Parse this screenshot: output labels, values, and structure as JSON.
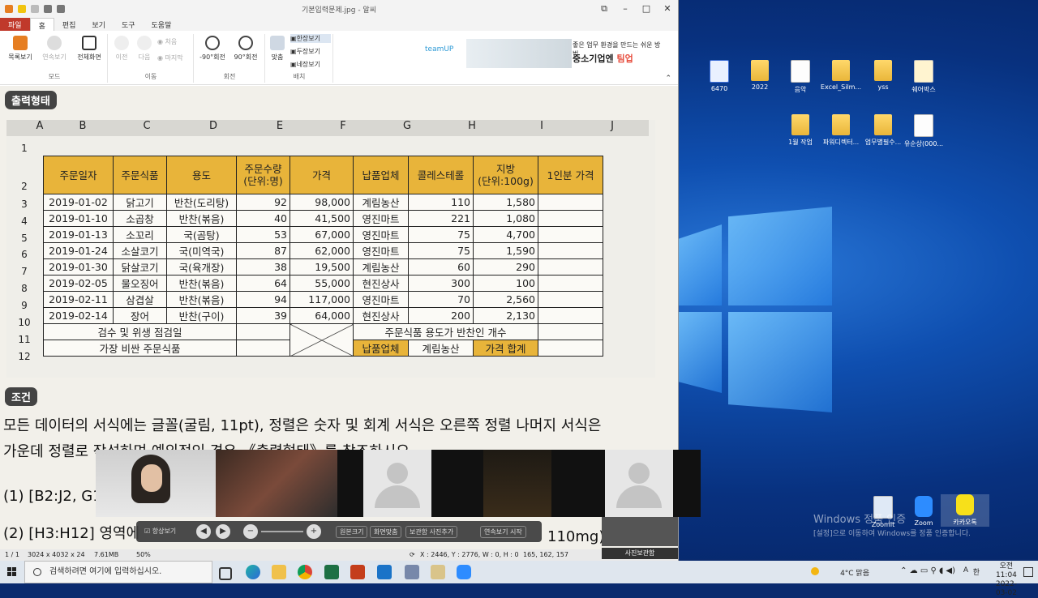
{
  "window": {
    "title": "기본입력문제.jpg - 알씨",
    "buttons": [
      "⧉",
      "–",
      "□",
      "✕"
    ]
  },
  "ribbon": {
    "tabs": [
      "파일",
      "홈",
      "편집",
      "보기",
      "도구",
      "도움말"
    ],
    "buttons": {
      "list_view": "목록보기",
      "slideshow": "연속보기",
      "fullscreen": "전체화면",
      "prev": "이전",
      "next": "다음",
      "first": "처음",
      "last": "마지막",
      "rot_ccw": "-90°회전",
      "rot_cw": "90°회전",
      "fit": "맞춤",
      "one_page": "한장보기",
      "two_page": "두장보기",
      "four_page": "네장보기"
    },
    "groups": {
      "mode": "모드",
      "move": "이동",
      "rotate": "회전",
      "layout": "배치"
    },
    "ad": {
      "brand": "teamUP",
      "line1": "좋은 업무 환경을 만드는 쉬운 방법",
      "line2": "중소기업엔",
      "line2_accent": "팀업"
    }
  },
  "document": {
    "output_tag": "출력형태",
    "conditions_tag": "조건",
    "col_headers": [
      "A",
      "B",
      "C",
      "D",
      "E",
      "F",
      "G",
      "H",
      "I",
      "J"
    ],
    "row_headers": [
      "1",
      "2",
      "3",
      "4",
      "5",
      "6",
      "7",
      "8",
      "9",
      "10",
      "11",
      "12"
    ],
    "table_headers": [
      "주문일자",
      "주문식품",
      "용도",
      "주문수량\n(단위:명)",
      "가격",
      "납품업체",
      "콜레스테롤",
      "지방\n(단위:100g)",
      "1인분 가격"
    ],
    "rows": [
      [
        "2019-01-02",
        "닭고기",
        "반찬(도리탕)",
        "92",
        "98,000",
        "계림농산",
        "110",
        "1,580",
        ""
      ],
      [
        "2019-01-10",
        "소곱창",
        "반찬(볶음)",
        "40",
        "41,500",
        "영진마트",
        "221",
        "1,080",
        ""
      ],
      [
        "2019-01-13",
        "소꼬리",
        "국(곰탕)",
        "53",
        "67,000",
        "영진마트",
        "75",
        "4,700",
        ""
      ],
      [
        "2019-01-24",
        "소살코기",
        "국(미역국)",
        "87",
        "62,000",
        "영진마트",
        "75",
        "1,590",
        ""
      ],
      [
        "2019-01-30",
        "닭살코기",
        "국(육개장)",
        "38",
        "19,500",
        "계림농산",
        "60",
        "290",
        ""
      ],
      [
        "2019-02-05",
        "물오징어",
        "반찬(볶음)",
        "64",
        "55,000",
        "현진상사",
        "300",
        "100",
        ""
      ],
      [
        "2019-02-11",
        "삼겹살",
        "반찬(볶음)",
        "94",
        "117,000",
        "영진마트",
        "70",
        "2,560",
        ""
      ],
      [
        "2019-02-14",
        "장어",
        "반찬(구이)",
        "39",
        "64,000",
        "현진상사",
        "200",
        "2,130",
        ""
      ]
    ],
    "row11_label": "검수 및 위생 점검일",
    "row11_right": "주문식품 용도가 반찬인 개수",
    "row12_label": "가장 비싼 주문식품",
    "row12_supplier_label": "납품업체",
    "row12_supplier_value": "계림농산",
    "row12_price_label": "가격 합계",
    "para1": "모든 데이터의 서식에는 글꼴(굴림, 11pt), 정렬은 숫자 및 회계 서식은 오른쪽 정렬 나머지 서식은",
    "para2": "가운데 정렬로 작성하며 예외적인 경우 《출력형태》를 참조하시오.",
    "para3": "(1)  [B2:J2, G1",
    "para4": "(2)  [H3:H12] 영역에",
    "para4_tail": "110mg)."
  },
  "statusbar": {
    "page": "1 / 1",
    "dims": "3024 x 4032 x 24",
    "size": "7.61MB",
    "zoom": "50%",
    "coords": "X : 2446, Y : 2776, W : 0, H : 0",
    "rgb": "165, 162, 157",
    "photo_box": "사진보관함"
  },
  "viewer_controls": {
    "always_on_top": "항상보기",
    "original": "원본크기",
    "fit_screen": "화면맞춤",
    "share": "보관함 사진추가",
    "slideshow": "연속보기 시작"
  },
  "desktop": {
    "icons": [
      "6470",
      "2022",
      "음악",
      "Excel_Silm...",
      "yss",
      "쉐어박스",
      "1월 작업",
      "파워디렉터...",
      "업무별필수...",
      "유순상(000...",
      "Zoomit",
      "Zoom",
      "카카오톡"
    ],
    "activation_line1": "Windows 정품 인증",
    "activation_line2": "[설정]으로 이동하여 Windows를 정품 인증합니다."
  },
  "taskbar": {
    "search_placeholder": "검색하려면 여기에 입력하십시오.",
    "weather": "4°C  맑음",
    "ime": "A",
    "lang": "한",
    "time": "오전 11:04",
    "date": "2022-03-02"
  }
}
